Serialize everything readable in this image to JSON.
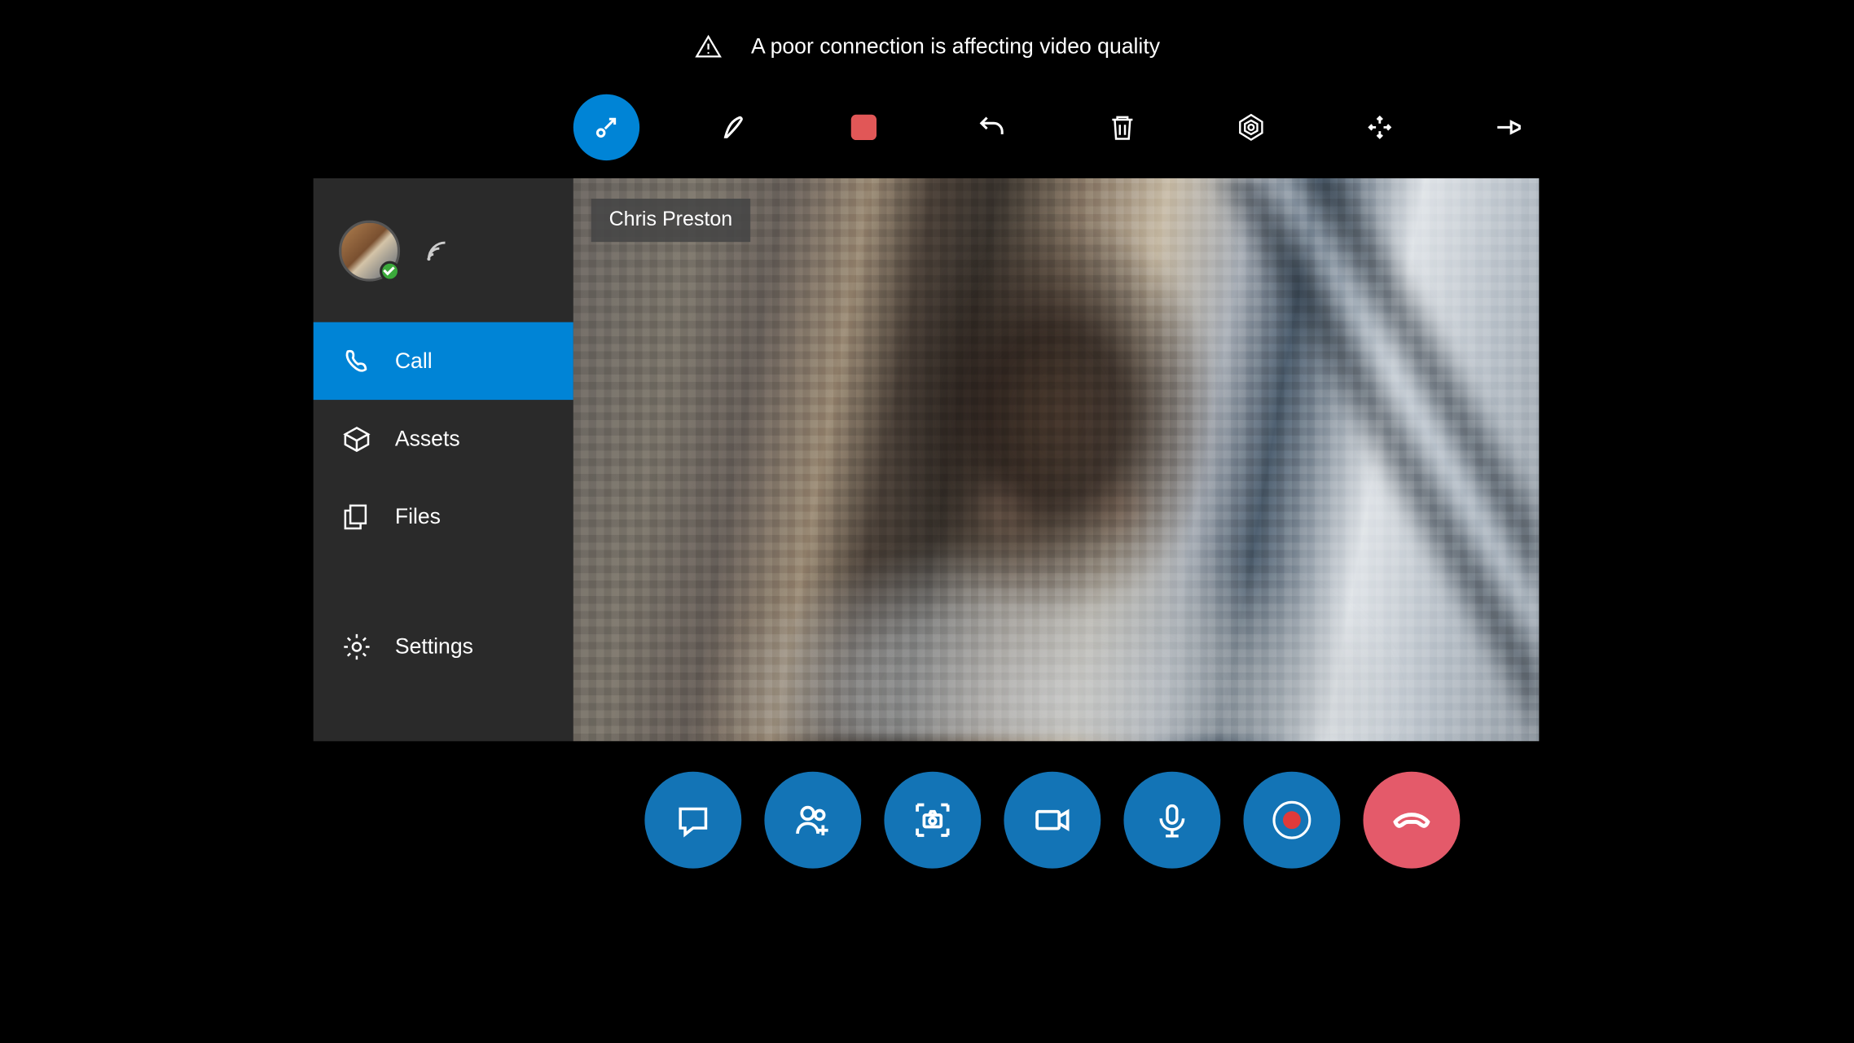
{
  "warning": {
    "text": "A poor connection is affecting video quality"
  },
  "toolbar": {
    "pointer": "pointer",
    "ink": "ink",
    "stop": "stop-shape",
    "undo": "undo",
    "delete": "delete",
    "aperture": "aperture",
    "expand": "expand",
    "pin": "pin"
  },
  "sidebar": {
    "call": "Call",
    "assets": "Assets",
    "files": "Files",
    "settings": "Settings"
  },
  "video": {
    "participant": "Chris Preston"
  },
  "controls": {
    "chat": "chat",
    "add": "add-participant",
    "capture": "capture",
    "camera": "camera",
    "mic": "mic",
    "record": "record",
    "hangup": "hang-up"
  }
}
